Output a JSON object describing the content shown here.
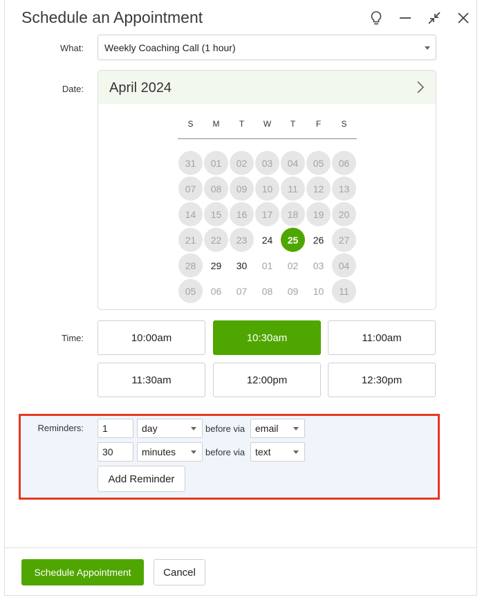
{
  "dialog": {
    "title": "Schedule an Appointment",
    "icons": [
      "lightbulb-icon",
      "minimize-icon",
      "collapse-icon",
      "close-icon"
    ]
  },
  "what": {
    "label": "What:",
    "value": "Weekly Coaching Call (1 hour)"
  },
  "date": {
    "label": "Date:",
    "month": "April 2024",
    "weekdays": [
      "S",
      "M",
      "T",
      "W",
      "T",
      "F",
      "S"
    ],
    "days": [
      {
        "t": "31",
        "s": "disabled"
      },
      {
        "t": "01",
        "s": "disabled"
      },
      {
        "t": "02",
        "s": "disabled"
      },
      {
        "t": "03",
        "s": "disabled"
      },
      {
        "t": "04",
        "s": "disabled"
      },
      {
        "t": "05",
        "s": "disabled"
      },
      {
        "t": "06",
        "s": "disabled"
      },
      {
        "t": "07",
        "s": "disabled"
      },
      {
        "t": "08",
        "s": "disabled"
      },
      {
        "t": "09",
        "s": "disabled"
      },
      {
        "t": "10",
        "s": "disabled"
      },
      {
        "t": "11",
        "s": "disabled"
      },
      {
        "t": "12",
        "s": "disabled"
      },
      {
        "t": "13",
        "s": "disabled"
      },
      {
        "t": "14",
        "s": "disabled"
      },
      {
        "t": "15",
        "s": "disabled"
      },
      {
        "t": "16",
        "s": "disabled"
      },
      {
        "t": "17",
        "s": "disabled"
      },
      {
        "t": "18",
        "s": "disabled"
      },
      {
        "t": "19",
        "s": "disabled"
      },
      {
        "t": "20",
        "s": "disabled"
      },
      {
        "t": "21",
        "s": "disabled"
      },
      {
        "t": "22",
        "s": "disabled"
      },
      {
        "t": "23",
        "s": "disabled"
      },
      {
        "t": "24",
        "s": "avail"
      },
      {
        "t": "25",
        "s": "selected"
      },
      {
        "t": "26",
        "s": "avail"
      },
      {
        "t": "27",
        "s": "disabled"
      },
      {
        "t": "28",
        "s": "disabled"
      },
      {
        "t": "29",
        "s": "avail"
      },
      {
        "t": "30",
        "s": "avail"
      },
      {
        "t": "01",
        "s": "muted"
      },
      {
        "t": "02",
        "s": "muted"
      },
      {
        "t": "03",
        "s": "muted"
      },
      {
        "t": "04",
        "s": "disabled"
      },
      {
        "t": "05",
        "s": "disabled"
      },
      {
        "t": "06",
        "s": "muted"
      },
      {
        "t": "07",
        "s": "muted"
      },
      {
        "t": "08",
        "s": "muted"
      },
      {
        "t": "09",
        "s": "muted"
      },
      {
        "t": "10",
        "s": "muted"
      },
      {
        "t": "11",
        "s": "disabled"
      }
    ]
  },
  "time": {
    "label": "Time:",
    "slots": [
      "10:00am",
      "10:30am",
      "11:00am",
      "11:30am",
      "12:00pm",
      "12:30pm"
    ],
    "selected": "10:30am"
  },
  "reminders": {
    "label": "Reminders:",
    "rows": [
      {
        "amount": "1",
        "unit": "day",
        "via_text": "before via",
        "channel": "email"
      },
      {
        "amount": "30",
        "unit": "minutes",
        "via_text": "before via",
        "channel": "text"
      }
    ],
    "add_label": "Add Reminder"
  },
  "footer": {
    "schedule_label": "Schedule Appointment",
    "cancel_label": "Cancel"
  },
  "colors": {
    "accent": "#4fa600",
    "highlight_border": "#e8371e",
    "reminder_bg": "#f0f5fc",
    "calendar_header_bg": "#f3f8ef"
  }
}
